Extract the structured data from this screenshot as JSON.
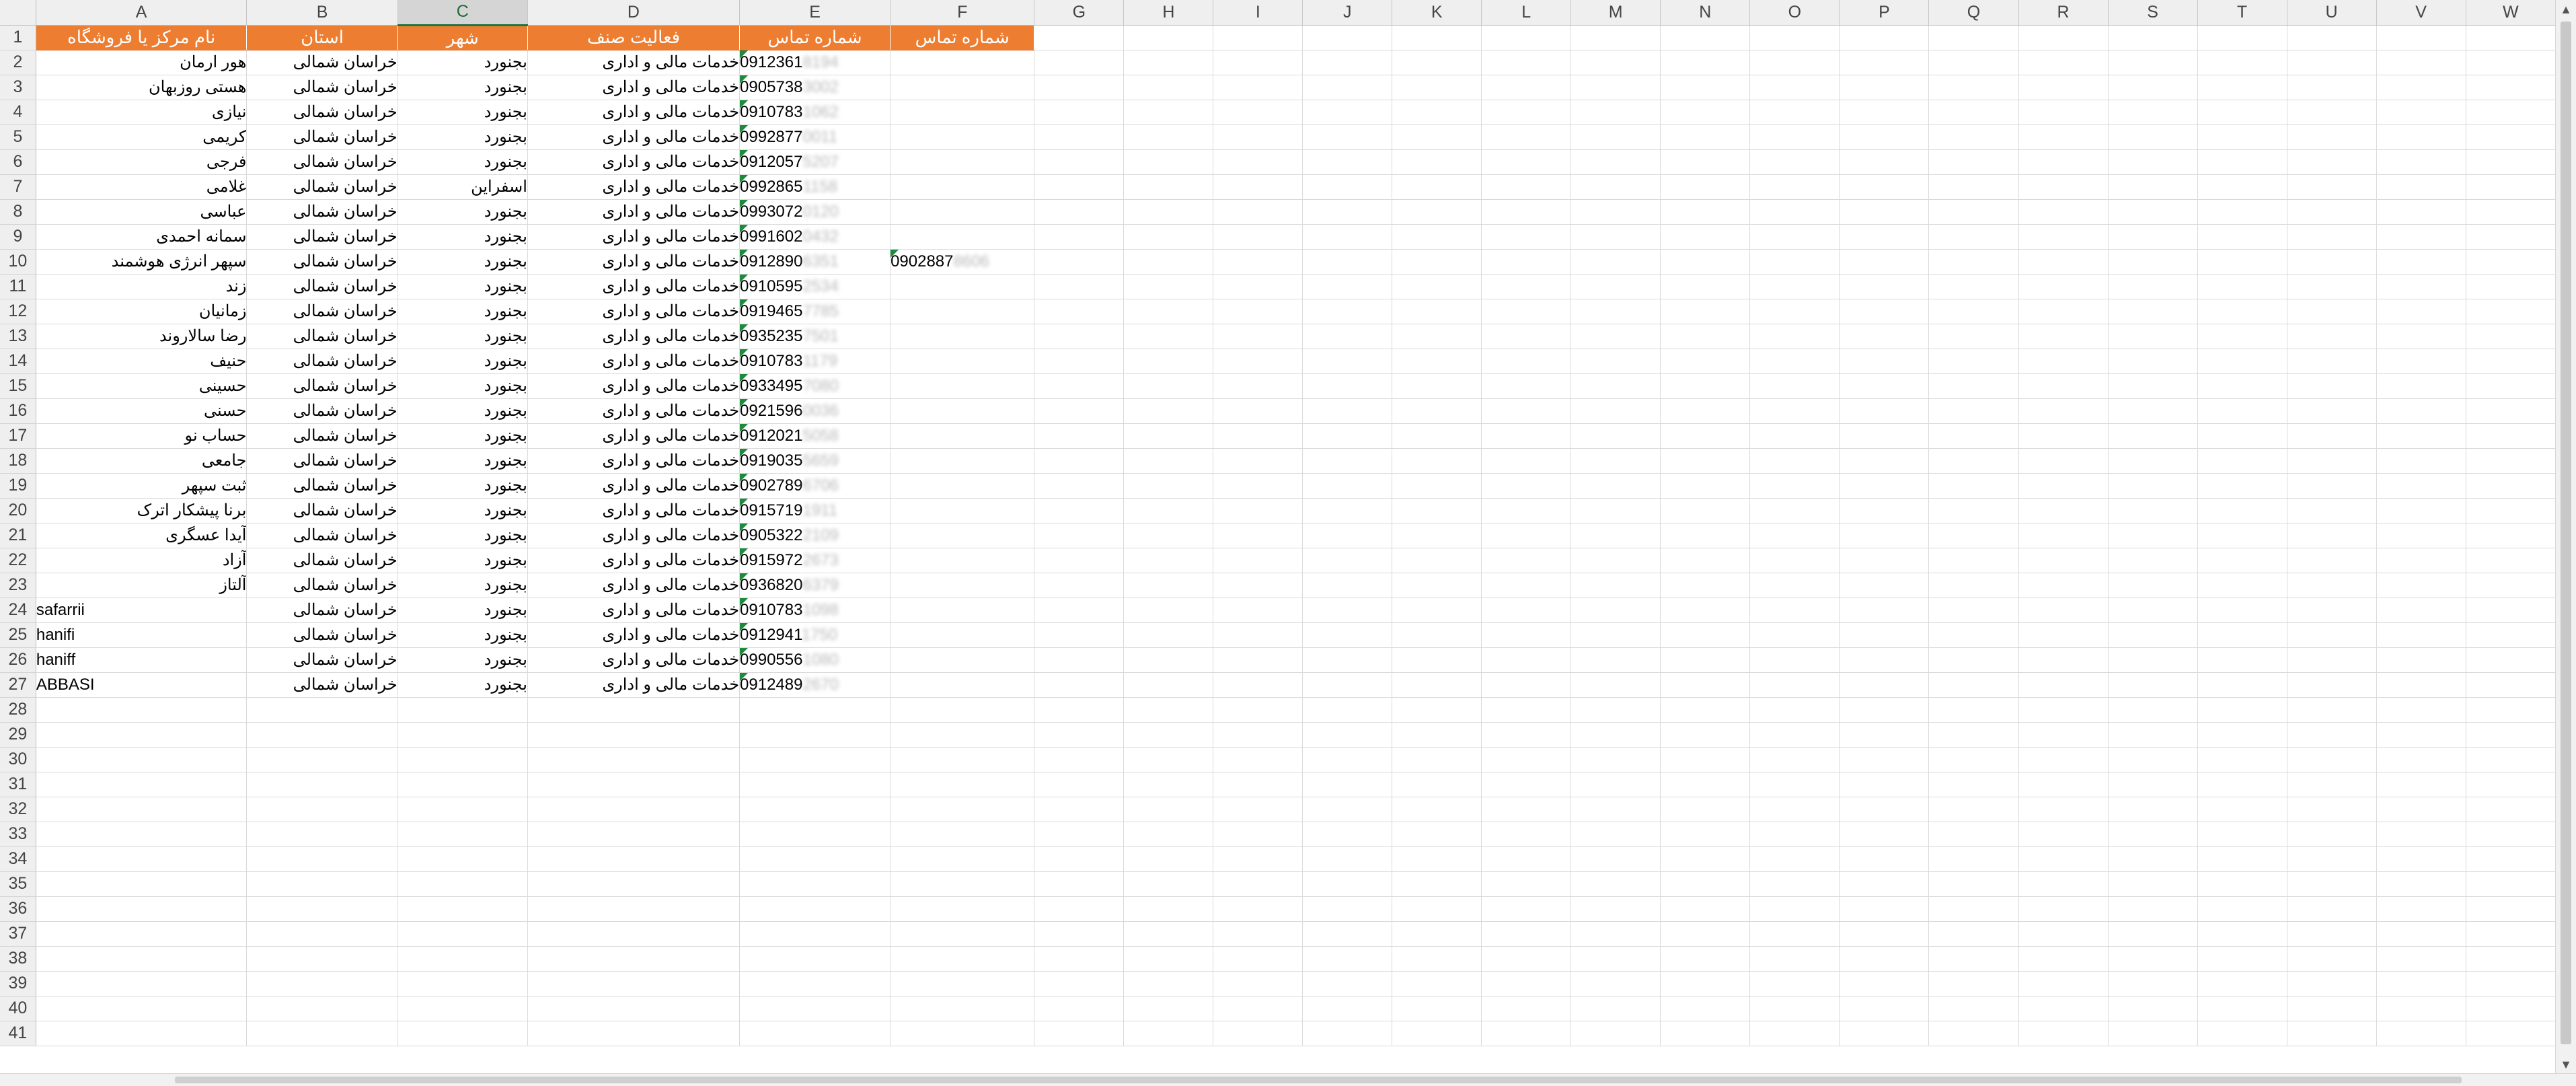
{
  "columns": [
    "A",
    "B",
    "C",
    "D",
    "E",
    "F",
    "G",
    "H",
    "I",
    "J",
    "K",
    "L",
    "M",
    "N",
    "O",
    "P",
    "Q",
    "R",
    "S",
    "T",
    "U",
    "V",
    "W"
  ],
  "selected_column": "C",
  "header_row": {
    "A": "نام مرکز یا فروشگاه",
    "B": "استان",
    "C": "شهر",
    "D": "فعالیت صنف",
    "E": "شماره تماس",
    "F": "شماره تماس"
  },
  "rows": [
    {
      "n": "2",
      "name": "هور ارمان",
      "province": "خراسان شمالی",
      "city": "بجنورد",
      "activity": "خدمات مالی و اداری",
      "phone": "0912361",
      "phone_hidden": "8194"
    },
    {
      "n": "3",
      "name": "هستی روزبهان",
      "province": "خراسان شمالی",
      "city": "بجنورد",
      "activity": "خدمات مالی و اداری",
      "phone": "0905738",
      "phone_hidden": "3002"
    },
    {
      "n": "4",
      "name": "نیازی",
      "province": "خراسان شمالی",
      "city": "بجنورد",
      "activity": "خدمات مالی و اداری",
      "phone": "0910783",
      "phone_hidden": "1062"
    },
    {
      "n": "5",
      "name": "کریمی",
      "province": "خراسان شمالی",
      "city": "بجنورد",
      "activity": "خدمات مالی و اداری",
      "phone": "0992877",
      "phone_hidden": "0011"
    },
    {
      "n": "6",
      "name": "فرجی",
      "province": "خراسان شمالی",
      "city": "بجنورد",
      "activity": "خدمات مالی و اداری",
      "phone": "0912057",
      "phone_hidden": "5207"
    },
    {
      "n": "7",
      "name": "غلامی",
      "province": "خراسان شمالی",
      "city": "اسفراین",
      "activity": "خدمات مالی و اداری",
      "phone": "0992865",
      "phone_hidden": "1158"
    },
    {
      "n": "8",
      "name": "عباسی",
      "province": "خراسان شمالی",
      "city": "بجنورد",
      "activity": "خدمات مالی و اداری",
      "phone": "0993072",
      "phone_hidden": "0120"
    },
    {
      "n": "9",
      "name": "سمانه احمدی",
      "province": "خراسان شمالی",
      "city": "بجنورد",
      "activity": "خدمات مالی و اداری",
      "phone": "0991602",
      "phone_hidden": "0432"
    },
    {
      "n": "10",
      "name": "سپهر انرژی هوشمند",
      "province": "خراسان شمالی",
      "city": "بجنورد",
      "activity": "خدمات مالی و اداری",
      "phone": "0912890",
      "phone_hidden": "6351",
      "phone2": "0902887",
      "phone2_hidden": "8606"
    },
    {
      "n": "11",
      "name": "زند",
      "province": "خراسان شمالی",
      "city": "بجنورد",
      "activity": "خدمات مالی و اداری",
      "phone": "0910595",
      "phone_hidden": "2534"
    },
    {
      "n": "12",
      "name": "زمانیان",
      "province": "خراسان شمالی",
      "city": "بجنورد",
      "activity": "خدمات مالی و اداری",
      "phone": "0919465",
      "phone_hidden": "7785"
    },
    {
      "n": "13",
      "name": "رضا سالاروند",
      "province": "خراسان شمالی",
      "city": "بجنورد",
      "activity": "خدمات مالی و اداری",
      "phone": "0935235",
      "phone_hidden": "7501"
    },
    {
      "n": "14",
      "name": "حنیف",
      "province": "خراسان شمالی",
      "city": "بجنورد",
      "activity": "خدمات مالی و اداری",
      "phone": "0910783",
      "phone_hidden": "1179"
    },
    {
      "n": "15",
      "name": "حسینی",
      "province": "خراسان شمالی",
      "city": "بجنورد",
      "activity": "خدمات مالی و اداری",
      "phone": "0933495",
      "phone_hidden": "7080"
    },
    {
      "n": "16",
      "name": "حسنی",
      "province": "خراسان شمالی",
      "city": "بجنورد",
      "activity": "خدمات مالی و اداری",
      "phone": "0921596",
      "phone_hidden": "0036"
    },
    {
      "n": "17",
      "name": "حساب نو",
      "province": "خراسان شمالی",
      "city": "بجنورد",
      "activity": "خدمات مالی و اداری",
      "phone": "0912021",
      "phone_hidden": "5058"
    },
    {
      "n": "18",
      "name": "جامعی",
      "province": "خراسان شمالی",
      "city": "بجنورد",
      "activity": "خدمات مالی و اداری",
      "phone": "0919035",
      "phone_hidden": "5659"
    },
    {
      "n": "19",
      "name": "ثبت سپهر",
      "province": "خراسان شمالی",
      "city": "بجنورد",
      "activity": "خدمات مالی و اداری",
      "phone": "0902789",
      "phone_hidden": "6706"
    },
    {
      "n": "20",
      "name": "برنا پیشکار اترک",
      "province": "خراسان شمالی",
      "city": "بجنورد",
      "activity": "خدمات مالی و اداری",
      "phone": "0915719",
      "phone_hidden": "1911"
    },
    {
      "n": "21",
      "name": "آیدا عسگری",
      "province": "خراسان شمالی",
      "city": "بجنورد",
      "activity": "خدمات مالی و اداری",
      "phone": "0905322",
      "phone_hidden": "2109"
    },
    {
      "n": "22",
      "name": "آزاد",
      "province": "خراسان شمالی",
      "city": "بجنورد",
      "activity": "خدمات مالی و اداری",
      "phone": "0915972",
      "phone_hidden": "2673"
    },
    {
      "n": "23",
      "name": "آلتاز",
      "province": "خراسان شمالی",
      "city": "بجنورد",
      "activity": "خدمات مالی و اداری",
      "phone": "0936820",
      "phone_hidden": "6379"
    },
    {
      "n": "24",
      "name": "safarrii",
      "province": "خراسان شمالی",
      "city": "بجنورد",
      "activity": "خدمات مالی و اداری",
      "phone": "0910783",
      "phone_hidden": "1098",
      "ltr": true
    },
    {
      "n": "25",
      "name": "hanifi",
      "province": "خراسان شمالی",
      "city": "بجنورد",
      "activity": "خدمات مالی و اداری",
      "phone": "0912941",
      "phone_hidden": "1750",
      "ltr": true
    },
    {
      "n": "26",
      "name": "haniff",
      "province": "خراسان شمالی",
      "city": "بجنورد",
      "activity": "خدمات مالی و اداری",
      "phone": "0990556",
      "phone_hidden": "1080",
      "ltr": true
    },
    {
      "n": "27",
      "name": "ABBASI",
      "province": "خراسان شمالی",
      "city": "بجنورد",
      "activity": "خدمات مالی و اداری",
      "phone": "0912489",
      "phone_hidden": "2670",
      "ltr": true
    }
  ],
  "empty_row_numbers": [
    "28",
    "29",
    "30",
    "31",
    "32",
    "33",
    "34",
    "35",
    "36",
    "37",
    "38",
    "39",
    "40",
    "41"
  ],
  "colors": {
    "header_fill": "#ed7d31",
    "header_text": "#ffffff",
    "comment_marker": "#1e8a3e",
    "selected_header": "#217346"
  }
}
